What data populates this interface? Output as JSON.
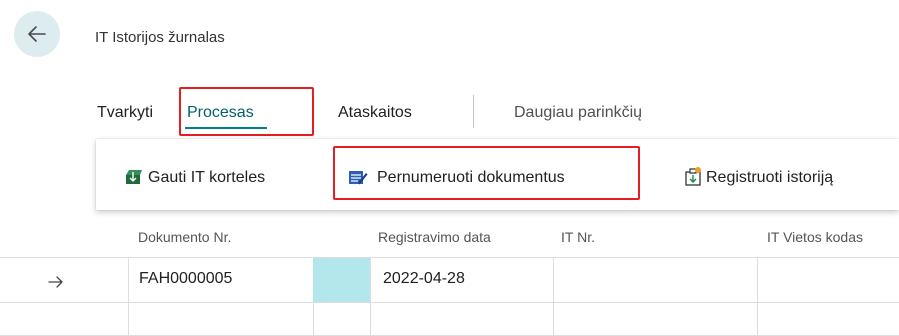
{
  "header": {
    "title": "IT Istorijos žurnalas"
  },
  "tabs": [
    {
      "label": "Tvarkyti"
    },
    {
      "label": "Procesas",
      "active": true
    },
    {
      "label": "Ataskaitos"
    },
    {
      "label": "Daugiau parinkčių"
    }
  ],
  "actions": [
    {
      "label": "Gauti IT korteles",
      "icon": "get-cards-icon"
    },
    {
      "label": "Pernumeruoti dokumentus",
      "icon": "renumber-documents-icon"
    },
    {
      "label": "Registruoti istoriją",
      "icon": "post-history-icon"
    }
  ],
  "table": {
    "columns": [
      "Dokumento Nr.",
      "Registravimo data",
      "IT Nr.",
      "IT Vietos kodas"
    ],
    "rows": [
      {
        "document_no": "FAH0000005",
        "posting_date": "2022-04-28",
        "it_no": "",
        "it_location_code": "",
        "current": true
      },
      {
        "document_no": "",
        "posting_date": "",
        "it_no": "",
        "it_location_code": "",
        "current": false
      }
    ]
  },
  "colors": {
    "accent": "#00808a",
    "highlight": "#e31e24",
    "selected_cell": "#b3e7ec",
    "back_button_bg": "#dcecef"
  }
}
